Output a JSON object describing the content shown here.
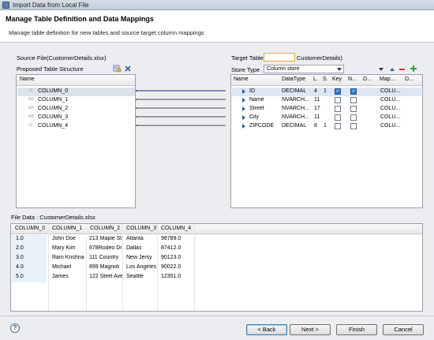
{
  "window": {
    "title": "Import Data from Local File"
  },
  "header": {
    "title": "Manage Table Definition and Data Mappings",
    "description": "Manage table definition for new tables and source target column mappings"
  },
  "source": {
    "file_label": "Source File(CustomerDetails.xlsx)",
    "structure_label": "Proposed Table Structure",
    "column_header": "Name",
    "rows": [
      {
        "type_glyph": "12",
        "name": "COLUMN_0"
      },
      {
        "type_glyph": "AB",
        "name": "COLUMN_1"
      },
      {
        "type_glyph": "AB",
        "name": "COLUMN_2"
      },
      {
        "type_glyph": "AB",
        "name": "COLUMN_3"
      },
      {
        "type_glyph": "12",
        "name": "COLUMN_4"
      }
    ]
  },
  "target": {
    "table_label": "Target Table",
    "table_name_input": "",
    "table_suffix": "CustomerDetails)",
    "store_type_label": "Store Type",
    "store_type_value": "Column store",
    "headers": [
      "Name",
      "DataType",
      "L.",
      "S.",
      "Key",
      "N...",
      "D...",
      "Map...",
      "D..."
    ],
    "rows": [
      {
        "name": "ID",
        "datatype": "DECIMAL",
        "length": "4",
        "scale": "1",
        "key": true,
        "nullable": true,
        "map": "COLU..."
      },
      {
        "name": "Name",
        "datatype": "NVARCH...",
        "length": "11",
        "scale": "",
        "key": false,
        "nullable": false,
        "map": "COLU..."
      },
      {
        "name": "Street",
        "datatype": "NVARCH...",
        "length": "17",
        "scale": "",
        "key": false,
        "nullable": false,
        "map": "COLU..."
      },
      {
        "name": "City",
        "datatype": "NVARCH...",
        "length": "11",
        "scale": "",
        "key": false,
        "nullable": false,
        "map": "COLU..."
      },
      {
        "name": "ZIPCODE",
        "datatype": "DECIMAL",
        "length": "8",
        "scale": "1",
        "key": false,
        "nullable": false,
        "map": "COLU..."
      }
    ]
  },
  "file_data": {
    "label": "File Data : CustomerDetails.xlsx",
    "headers": [
      "COLUMN_0",
      "COLUMN_1",
      "COLUMN_2",
      "COLUMN_3",
      "COLUMN_4"
    ],
    "rows": [
      [
        "1.0",
        "John Doe",
        "213 Maple St",
        "Atlanta",
        "98789.0"
      ],
      [
        "2.0",
        "Mary Kim",
        "678Rodeo Dr",
        "Dallas",
        "87412.0"
      ],
      [
        "3.0",
        "Ram Krishna",
        "111 Country",
        "New Jersy",
        "90123.0"
      ],
      [
        "4.0",
        "Michael",
        "899 Magnoli",
        "Los Angeles",
        "90022.0"
      ],
      [
        "5.0",
        "James",
        "122 Steel Ave",
        "Seattle",
        "12351.0"
      ]
    ]
  },
  "footer": {
    "help": "?",
    "back": "< Back",
    "next": "Next >",
    "finish": "Finish",
    "cancel": "Cancel"
  },
  "colors": {
    "accent": "#2f78cc",
    "input_highlight": "#f2a33a",
    "add_icon": "#2e9e3a",
    "remove_icon": "#d23a2a"
  }
}
